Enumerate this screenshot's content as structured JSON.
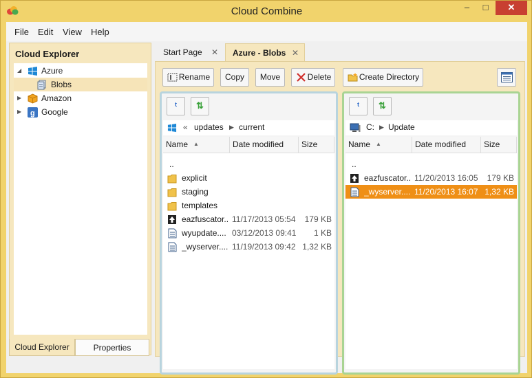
{
  "window": {
    "title": "Cloud Combine"
  },
  "menu": [
    "File",
    "Edit",
    "View",
    "Help"
  ],
  "left_pane": {
    "header": "Cloud Explorer",
    "tree": [
      {
        "label": "Azure",
        "expanded": true,
        "icon": "windows-icon"
      },
      {
        "label": "Blobs",
        "selected": true,
        "icon": "blob-icon"
      },
      {
        "label": "Amazon",
        "expanded": false,
        "icon": "amazon-box-icon"
      },
      {
        "label": "Google",
        "expanded": false,
        "icon": "google-icon"
      }
    ],
    "tabs": [
      "Cloud Explorer",
      "Properties"
    ]
  },
  "doc_tabs": [
    {
      "label": "Start Page",
      "close": "✕"
    },
    {
      "label": "Azure - Blobs",
      "close": "✕",
      "active": true
    }
  ],
  "toolbar": {
    "rename": "Rename",
    "copy": "Copy",
    "move": "Move",
    "delete": "Delete",
    "create_directory": "Create Directory"
  },
  "left_panel": {
    "breadcrumb": [
      "updates",
      "current"
    ],
    "breadcrumb_prefix": "«",
    "columns": [
      "Name",
      "Date modified",
      "Size"
    ],
    "rows": [
      {
        "name": "..",
        "date": "",
        "size": "",
        "icon": ""
      },
      {
        "name": "explicit",
        "date": "",
        "size": "",
        "icon": "folder-icon"
      },
      {
        "name": "staging",
        "date": "",
        "size": "",
        "icon": "folder-icon"
      },
      {
        "name": "templates",
        "date": "",
        "size": "",
        "icon": "folder-icon"
      },
      {
        "name": "eazfuscator...",
        "date": "11/17/2013 05:54",
        "size": "179 KB",
        "icon": "upload-file-icon"
      },
      {
        "name": "wyupdate....",
        "date": "03/12/2013 09:41",
        "size": "1 KB",
        "icon": "document-icon"
      },
      {
        "name": "_wyserver....",
        "date": "11/19/2013 09:42",
        "size": "1,32 KB",
        "icon": "document-icon"
      }
    ]
  },
  "right_panel": {
    "breadcrumb": [
      "C:",
      "Update"
    ],
    "columns": [
      "Name",
      "Date modified",
      "Size"
    ],
    "rows": [
      {
        "name": "..",
        "date": "",
        "size": "",
        "icon": ""
      },
      {
        "name": "eazfuscator...",
        "date": "11/20/2013 16:05",
        "size": "179 KB",
        "icon": "upload-file-icon"
      },
      {
        "name": "_wyserver....",
        "date": "11/20/2013 16:07",
        "size": "1,32 KB",
        "icon": "document-icon",
        "selected": true
      }
    ]
  },
  "colors": {
    "frame": "#f1d36c",
    "pane": "#f6e7be",
    "left_panel_border": "#b8d4de",
    "right_panel_border": "#a9d493",
    "selection": "#ef8f16",
    "close_button": "#c84031"
  }
}
